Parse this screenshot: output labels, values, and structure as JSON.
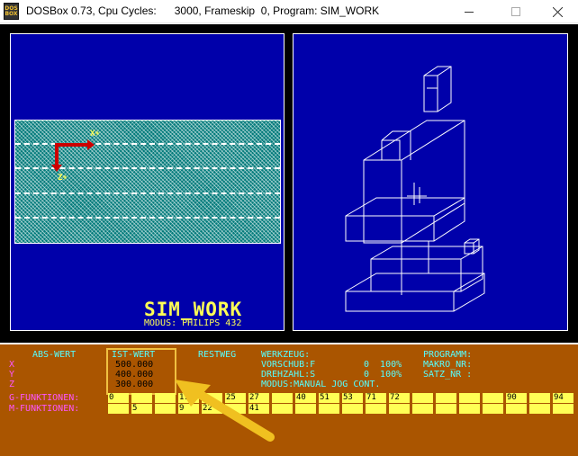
{
  "window": {
    "title": "DOSBox 0.73, Cpu Cycles:      3000, Frameskip  0, Program: SIM_WORK",
    "icon_top": "DOS",
    "icon_bottom": "BOX",
    "icons": [
      "dosbox-app-icon",
      "minimize-icon",
      "maximize-icon",
      "close-icon"
    ]
  },
  "left_panel": {
    "axis_x": "X+",
    "axis_z": "Z+",
    "program_name": "SIM_WORK",
    "modus": "MODUS: PHILIPS 432"
  },
  "status": {
    "abs_wert": "ABS-WERT",
    "ist_wert": "IST-WERT",
    "restweg": "RESTWEG",
    "axes": [
      "X",
      "Y",
      "Z"
    ],
    "values": [
      "500.000",
      "400.000",
      "300.000"
    ],
    "werkzeug": "WERKZEUG:",
    "vorschub": "VORSCHUB:F",
    "drehzahl": "DREHZAHL:S",
    "modus": "MODUS:MANUAL JOG CONT.",
    "vorschub_val": "0  100%",
    "drehzahl_val": "0  100%",
    "programm": "PROGRAMM:",
    "makro_nr": "MAKRO_NR:",
    "satz_nr": "SATZ_NR :",
    "g_label": "G-FUNKTIONEN:",
    "m_label": "M-FUNKTIONEN:",
    "g_cells": [
      "0",
      "",
      "",
      "17",
      "",
      "25",
      "27",
      "",
      "40",
      "51",
      "53",
      "71",
      "72",
      "",
      "",
      "",
      "",
      "90",
      "",
      "94"
    ],
    "m_cells": [
      "",
      "5",
      "",
      "9",
      "22",
      "",
      "41",
      "",
      "",
      "",
      "",
      "",
      "",
      "",
      "",
      "",
      "",
      "",
      "",
      ""
    ]
  },
  "colors": {
    "screen_blue": "#0000aa",
    "status_brown": "#aa5500",
    "text_cyan": "#55ffff",
    "text_yellow": "#ffff55",
    "text_magenta": "#ff55ff",
    "highlight_box": "#f0c040"
  }
}
